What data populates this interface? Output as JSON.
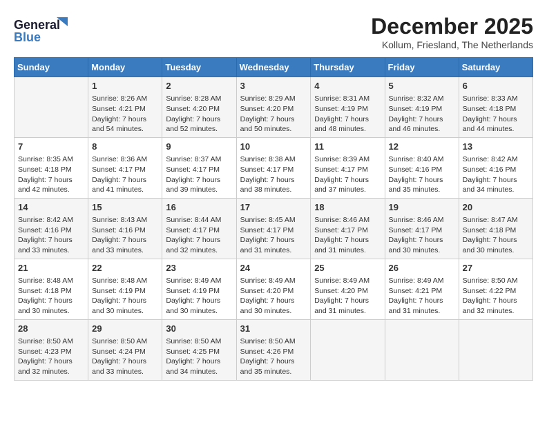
{
  "header": {
    "logo_line1": "General",
    "logo_line2": "Blue",
    "month": "December 2025",
    "location": "Kollum, Friesland, The Netherlands"
  },
  "days_of_week": [
    "Sunday",
    "Monday",
    "Tuesday",
    "Wednesday",
    "Thursday",
    "Friday",
    "Saturday"
  ],
  "weeks": [
    [
      {
        "day": "",
        "content": ""
      },
      {
        "day": "1",
        "content": "Sunrise: 8:26 AM\nSunset: 4:21 PM\nDaylight: 7 hours\nand 54 minutes."
      },
      {
        "day": "2",
        "content": "Sunrise: 8:28 AM\nSunset: 4:20 PM\nDaylight: 7 hours\nand 52 minutes."
      },
      {
        "day": "3",
        "content": "Sunrise: 8:29 AM\nSunset: 4:20 PM\nDaylight: 7 hours\nand 50 minutes."
      },
      {
        "day": "4",
        "content": "Sunrise: 8:31 AM\nSunset: 4:19 PM\nDaylight: 7 hours\nand 48 minutes."
      },
      {
        "day": "5",
        "content": "Sunrise: 8:32 AM\nSunset: 4:19 PM\nDaylight: 7 hours\nand 46 minutes."
      },
      {
        "day": "6",
        "content": "Sunrise: 8:33 AM\nSunset: 4:18 PM\nDaylight: 7 hours\nand 44 minutes."
      }
    ],
    [
      {
        "day": "7",
        "content": "Sunrise: 8:35 AM\nSunset: 4:18 PM\nDaylight: 7 hours\nand 42 minutes."
      },
      {
        "day": "8",
        "content": "Sunrise: 8:36 AM\nSunset: 4:17 PM\nDaylight: 7 hours\nand 41 minutes."
      },
      {
        "day": "9",
        "content": "Sunrise: 8:37 AM\nSunset: 4:17 PM\nDaylight: 7 hours\nand 39 minutes."
      },
      {
        "day": "10",
        "content": "Sunrise: 8:38 AM\nSunset: 4:17 PM\nDaylight: 7 hours\nand 38 minutes."
      },
      {
        "day": "11",
        "content": "Sunrise: 8:39 AM\nSunset: 4:17 PM\nDaylight: 7 hours\nand 37 minutes."
      },
      {
        "day": "12",
        "content": "Sunrise: 8:40 AM\nSunset: 4:16 PM\nDaylight: 7 hours\nand 35 minutes."
      },
      {
        "day": "13",
        "content": "Sunrise: 8:42 AM\nSunset: 4:16 PM\nDaylight: 7 hours\nand 34 minutes."
      }
    ],
    [
      {
        "day": "14",
        "content": "Sunrise: 8:42 AM\nSunset: 4:16 PM\nDaylight: 7 hours\nand 33 minutes."
      },
      {
        "day": "15",
        "content": "Sunrise: 8:43 AM\nSunset: 4:16 PM\nDaylight: 7 hours\nand 33 minutes."
      },
      {
        "day": "16",
        "content": "Sunrise: 8:44 AM\nSunset: 4:17 PM\nDaylight: 7 hours\nand 32 minutes."
      },
      {
        "day": "17",
        "content": "Sunrise: 8:45 AM\nSunset: 4:17 PM\nDaylight: 7 hours\nand 31 minutes."
      },
      {
        "day": "18",
        "content": "Sunrise: 8:46 AM\nSunset: 4:17 PM\nDaylight: 7 hours\nand 31 minutes."
      },
      {
        "day": "19",
        "content": "Sunrise: 8:46 AM\nSunset: 4:17 PM\nDaylight: 7 hours\nand 30 minutes."
      },
      {
        "day": "20",
        "content": "Sunrise: 8:47 AM\nSunset: 4:18 PM\nDaylight: 7 hours\nand 30 minutes."
      }
    ],
    [
      {
        "day": "21",
        "content": "Sunrise: 8:48 AM\nSunset: 4:18 PM\nDaylight: 7 hours\nand 30 minutes."
      },
      {
        "day": "22",
        "content": "Sunrise: 8:48 AM\nSunset: 4:19 PM\nDaylight: 7 hours\nand 30 minutes."
      },
      {
        "day": "23",
        "content": "Sunrise: 8:49 AM\nSunset: 4:19 PM\nDaylight: 7 hours\nand 30 minutes."
      },
      {
        "day": "24",
        "content": "Sunrise: 8:49 AM\nSunset: 4:20 PM\nDaylight: 7 hours\nand 30 minutes."
      },
      {
        "day": "25",
        "content": "Sunrise: 8:49 AM\nSunset: 4:20 PM\nDaylight: 7 hours\nand 31 minutes."
      },
      {
        "day": "26",
        "content": "Sunrise: 8:49 AM\nSunset: 4:21 PM\nDaylight: 7 hours\nand 31 minutes."
      },
      {
        "day": "27",
        "content": "Sunrise: 8:50 AM\nSunset: 4:22 PM\nDaylight: 7 hours\nand 32 minutes."
      }
    ],
    [
      {
        "day": "28",
        "content": "Sunrise: 8:50 AM\nSunset: 4:23 PM\nDaylight: 7 hours\nand 32 minutes."
      },
      {
        "day": "29",
        "content": "Sunrise: 8:50 AM\nSunset: 4:24 PM\nDaylight: 7 hours\nand 33 minutes."
      },
      {
        "day": "30",
        "content": "Sunrise: 8:50 AM\nSunset: 4:25 PM\nDaylight: 7 hours\nand 34 minutes."
      },
      {
        "day": "31",
        "content": "Sunrise: 8:50 AM\nSunset: 4:26 PM\nDaylight: 7 hours\nand 35 minutes."
      },
      {
        "day": "",
        "content": ""
      },
      {
        "day": "",
        "content": ""
      },
      {
        "day": "",
        "content": ""
      }
    ]
  ]
}
